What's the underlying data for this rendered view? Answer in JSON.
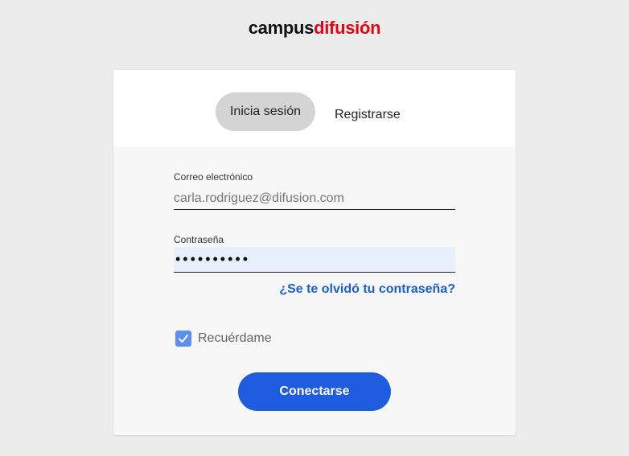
{
  "brand": {
    "name_part_1": "campus",
    "name_part_2": "difusión"
  },
  "tabs": [
    {
      "label": "Inicia sesión",
      "active": true
    },
    {
      "label": "Registrarse",
      "active": false
    }
  ],
  "form": {
    "email_label": "Correo electrónico",
    "email_value": "carla.rodriguez@difusion.com",
    "password_label": "Contraseña",
    "password_display": "••••••••••",
    "forgot_link": "¿Se te olvidó tu contraseña?",
    "remember_label": "Recuérdame",
    "remember_checked": true,
    "submit_label": "Conectarse"
  },
  "colors": {
    "brand_dark": "#111111",
    "brand_red": "#e30613",
    "primary_button": "#1f5ce0",
    "link": "#1a5fd0",
    "checkbox": "#5b8ff0",
    "autofill_background": "#e8f0fe"
  },
  "icons": {
    "checkbox_mark": "checkmark-icon"
  }
}
